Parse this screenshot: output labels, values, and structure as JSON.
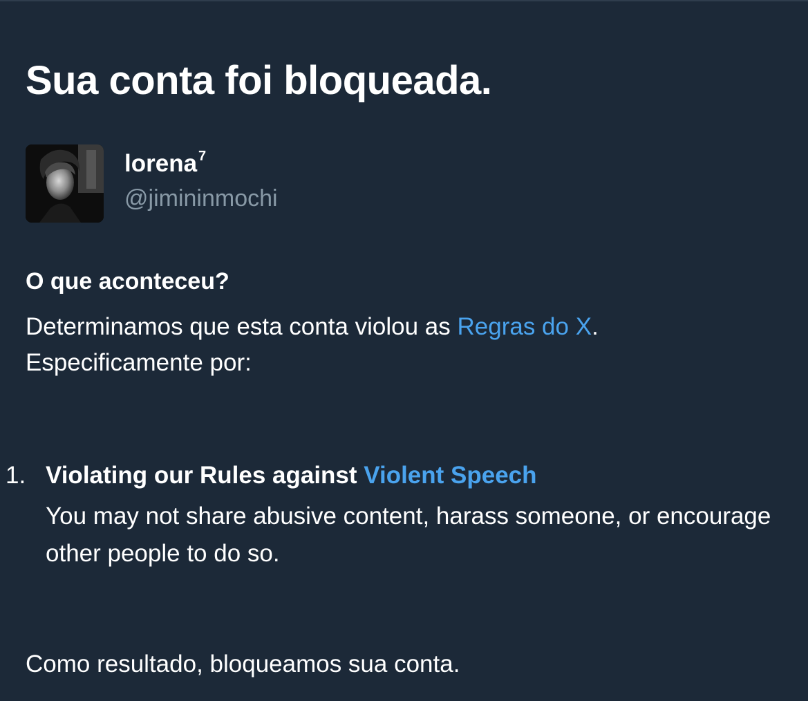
{
  "title": "Sua conta foi bloqueada.",
  "account": {
    "display_name": "lorena",
    "display_name_suffix": "7",
    "handle": "@jimininmochi",
    "avatar_icon": "profile-photo"
  },
  "what_happened": {
    "heading": "O que aconteceu?",
    "text_before_link": "Determinamos que esta conta violou as ",
    "rules_link": "Regras do X",
    "text_after_link": ".",
    "specifically": "Especificamente por:"
  },
  "violations": [
    {
      "number": "1.",
      "title_prefix": "Violating our Rules against ",
      "title_link": "Violent Speech",
      "description": "You may not share abusive content, harass someone, or encourage other people to do so."
    }
  ],
  "result": "Como resultado, bloqueamos sua conta.",
  "colors": {
    "background": "#1c2938",
    "text": "#ffffff",
    "secondary_text": "#8899a6",
    "link": "#4aa3ee"
  }
}
